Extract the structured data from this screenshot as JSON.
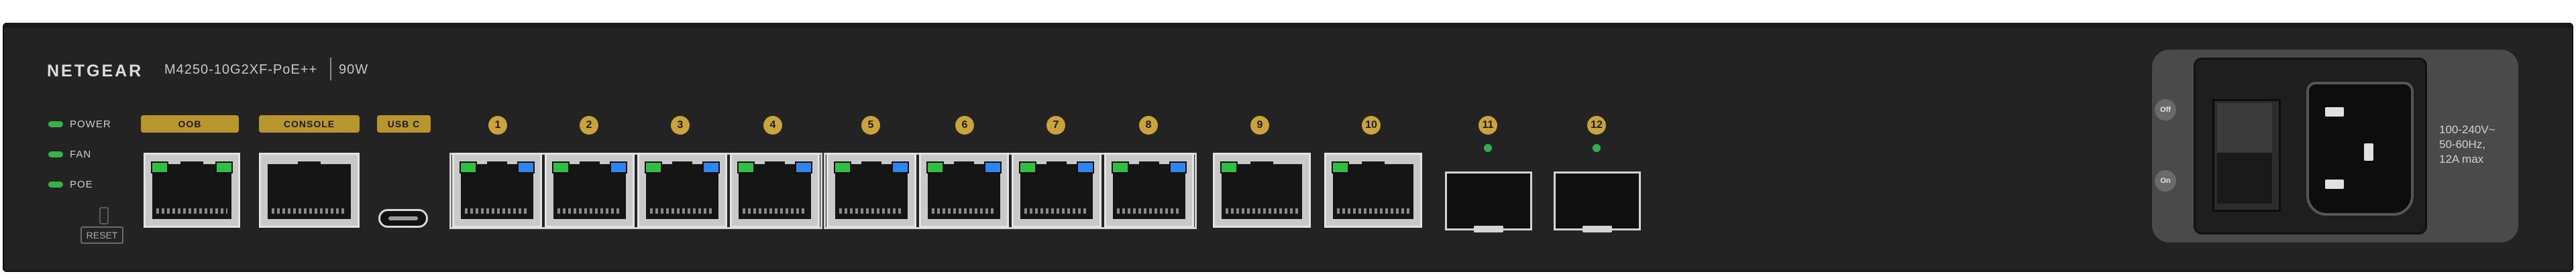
{
  "device": {
    "brand": "NETGEAR",
    "model": "M4250-10G2XF-PoE++",
    "power_budget": "90W"
  },
  "status_leds": [
    {
      "label": "POWER",
      "color": "#35b347"
    },
    {
      "label": "FAN",
      "color": "#35b347"
    },
    {
      "label": "POE",
      "color": "#35b347"
    }
  ],
  "reset": {
    "label": "RESET"
  },
  "mgmt_ports": [
    {
      "label": "OOB"
    },
    {
      "label": "CONSOLE"
    },
    {
      "label": "USB C"
    }
  ],
  "port_numbers": [
    "1",
    "2",
    "3",
    "4",
    "5",
    "6",
    "7",
    "8",
    "9",
    "10",
    "11",
    "12"
  ],
  "psu": {
    "off_label": "Off",
    "on_label": "On",
    "rating_lines": [
      "100-240V~",
      "50-60Hz,",
      "12A max"
    ]
  },
  "colors": {
    "chassis": "#232323",
    "accent_gold": "#c9a43a",
    "link_led": "#2ec040",
    "poe_led": "#2d86f0"
  }
}
